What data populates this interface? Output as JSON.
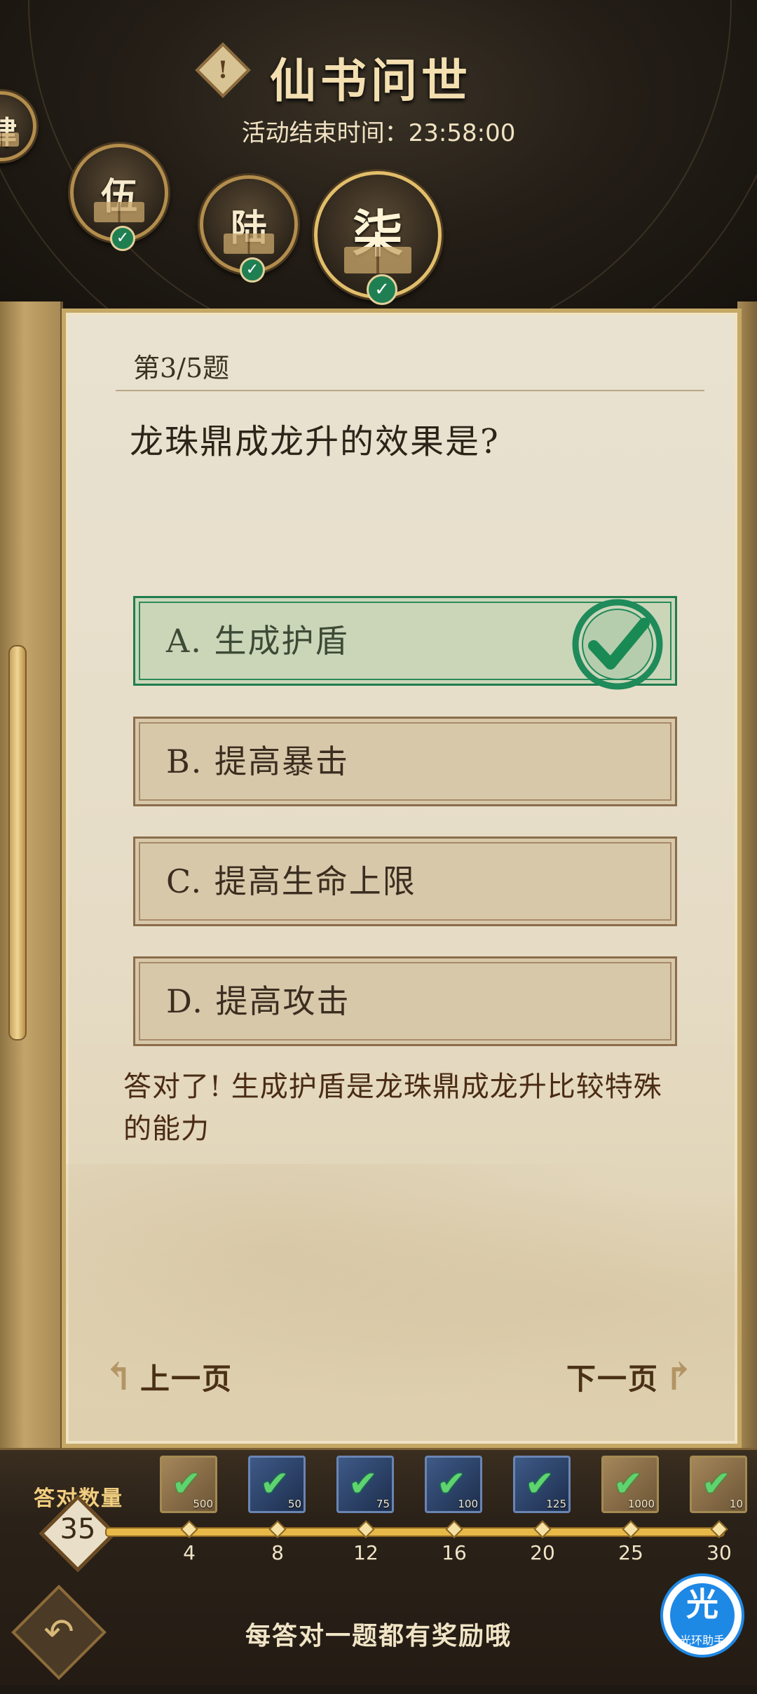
{
  "header": {
    "title": "仙书问世",
    "end_time_label": "活动结束时间：23:58:00",
    "alert_symbol": "!",
    "chapters": [
      {
        "label": "肆",
        "completed": true
      },
      {
        "label": "伍",
        "completed": true
      },
      {
        "label": "陆",
        "completed": true
      },
      {
        "label": "柒",
        "completed": true,
        "active": true
      }
    ],
    "check_symbol": "✓"
  },
  "quiz": {
    "question_number": "第3/5题",
    "question": "龙珠鼎成龙升的效果是?",
    "options": [
      {
        "label": "A. 生成护盾",
        "correct": true
      },
      {
        "label": "B. 提高暴击",
        "correct": false
      },
      {
        "label": "C. 提高生命上限",
        "correct": false
      },
      {
        "label": "D. 提高攻击",
        "correct": false
      }
    ],
    "feedback": "答对了! 生成护盾是龙珠鼎成龙升比较特殊的能力",
    "prev_label": "上一页",
    "next_label": "下一页"
  },
  "rewards": {
    "count_label": "答对数量",
    "count_value": "35",
    "items": [
      {
        "qty": "500",
        "style": "gold",
        "icon": "scroll-icon"
      },
      {
        "qty": "50",
        "style": "blue",
        "icon": "book-icon"
      },
      {
        "qty": "75",
        "style": "blue",
        "icon": "book-icon"
      },
      {
        "qty": "100",
        "style": "blue",
        "icon": "book-icon"
      },
      {
        "qty": "125",
        "style": "blue",
        "icon": "book-icon"
      },
      {
        "qty": "1000",
        "style": "gold",
        "icon": "scroll-icon"
      },
      {
        "qty": "10",
        "style": "gold",
        "icon": "herb-icon"
      }
    ],
    "ticks": [
      "4",
      "8",
      "12",
      "16",
      "20",
      "25",
      "30"
    ],
    "claimed_symbol": "✔"
  },
  "footer": {
    "hint": "每答对一题都有奖励哦",
    "back_symbol": "↶",
    "helper_char": "光",
    "helper_text": "光环助手"
  },
  "colors": {
    "correct_green": "#1f7d4e",
    "parchment": "#e6dcc6",
    "gold": "#e7b949",
    "feedback_brown": "#4a2b14"
  }
}
